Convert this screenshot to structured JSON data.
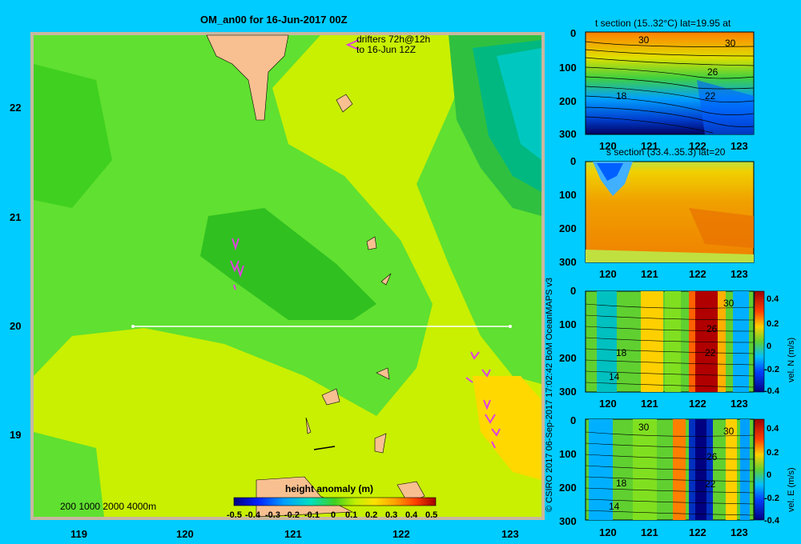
{
  "main_map": {
    "title": "OM_an00 for 16-Jun-2017 00Z",
    "drifters_label_1": "drifters 72h@12h",
    "drifters_label_2": "to 16-Jun 12Z",
    "depth_legend": "200  1000  2000  4000m",
    "colorbar_title": "height anomaly  (m)",
    "colorbar_ticks": [
      "-0.5",
      "-0.4",
      "-0.3",
      "-0.2",
      "-0.1",
      "0",
      "0.1",
      "0.2",
      "0.3",
      "0.4",
      "0.5"
    ],
    "y_ticks": [
      "22",
      "21",
      "20",
      "19"
    ],
    "x_ticks": [
      "119",
      "120",
      "121",
      "122",
      "123"
    ]
  },
  "credit": "© CSIRO 2017   06-Sep-2017 17:02:42 BoM OceanMAPS v3",
  "sections": [
    {
      "title": "t section (15..32°C) lat=19.95 at",
      "y_ticks": [
        "0",
        "100",
        "200",
        "300"
      ],
      "x_ticks": [
        "120",
        "121",
        "122",
        "123"
      ],
      "contour_labels": [
        "30",
        "30",
        "26",
        "18",
        "22"
      ]
    },
    {
      "title": "s section (33.4..35.3) lat=20",
      "y_ticks": [
        "0",
        "100",
        "200",
        "300"
      ],
      "x_ticks": [
        "120",
        "121",
        "122",
        "123"
      ],
      "contour_labels": []
    },
    {
      "title": "",
      "y_ticks": [
        "0",
        "100",
        "200",
        "300"
      ],
      "x_ticks": [
        "120",
        "121",
        "122",
        "123"
      ],
      "contour_labels": [
        "30",
        "26",
        "18",
        "22",
        "14"
      ],
      "colorbar_label": "vel. N  (m/s)",
      "colorbar_ticks": [
        "0.4",
        "0.2",
        "0",
        "-0.2",
        "-0.4"
      ]
    },
    {
      "title": "",
      "y_ticks": [
        "0",
        "100",
        "200",
        "300"
      ],
      "x_ticks": [
        "120",
        "121",
        "122",
        "123"
      ],
      "contour_labels": [
        "30",
        "30",
        "26",
        "18",
        "22",
        "14"
      ],
      "colorbar_label": "vel. E  (m/s)",
      "colorbar_ticks": [
        "0.4",
        "0.2",
        "0",
        "-0.2",
        "-0.4"
      ]
    }
  ],
  "chart_data": [
    {
      "type": "heatmap",
      "title": "OM_an00 for 16-Jun-2017 00Z",
      "xlim": [
        118.5,
        123.5
      ],
      "ylim": [
        18.3,
        22.7
      ],
      "colorbar": {
        "label": "height anomaly (m)",
        "range": [
          -0.5,
          0.5
        ]
      },
      "section_line": {
        "lat": 20,
        "lon": [
          119.5,
          123.1
        ]
      }
    },
    {
      "type": "heatmap",
      "title": "t section (15..32°C) lat=19.95 at",
      "xlim": [
        119.5,
        123.2
      ],
      "ylim": [
        300,
        0
      ]
    },
    {
      "type": "heatmap",
      "title": "s section (33.4..35.3) lat=20",
      "xlim": [
        119.5,
        123.2
      ],
      "ylim": [
        300,
        0
      ]
    },
    {
      "type": "heatmap",
      "xlim": [
        119.5,
        123.2
      ],
      "ylim": [
        300,
        0
      ],
      "colorbar": {
        "label": "vel. N (m/s)",
        "range": [
          -0.4,
          0.4
        ]
      }
    },
    {
      "type": "heatmap",
      "xlim": [
        119.5,
        123.2
      ],
      "ylim": [
        300,
        0
      ],
      "colorbar": {
        "label": "vel. E (m/s)",
        "range": [
          -0.4,
          0.4
        ]
      }
    }
  ]
}
